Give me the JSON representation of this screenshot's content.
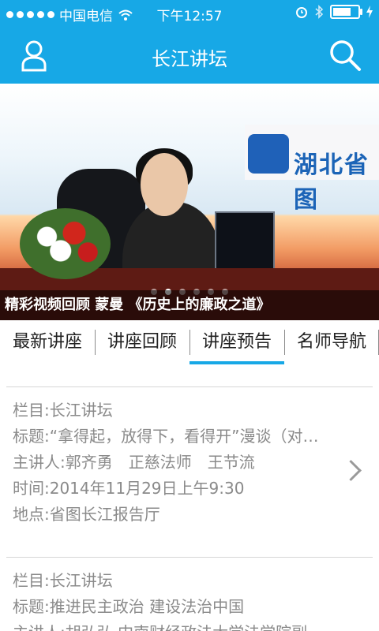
{
  "status_bar": {
    "carrier": "中国电信",
    "time": "下午12:57",
    "battery_level": 0.85
  },
  "nav": {
    "title": "长江讲坛",
    "user_icon": "user-icon",
    "search_icon": "search-icon"
  },
  "banner": {
    "caption": "精彩视频回顾  蒙曼 《历史上的廉政之道》",
    "sign_text": "湖北省图",
    "dots_count": 6,
    "active_dot": 1
  },
  "tabs": [
    {
      "label": "最新讲座",
      "active": false
    },
    {
      "label": "讲座回顾",
      "active": false
    },
    {
      "label": "讲座预告",
      "active": true
    },
    {
      "label": "名师导航",
      "active": false
    }
  ],
  "lectures": [
    {
      "column": "栏目:长江讲坛",
      "title": "标题:“拿得起，放得下，看得开”漫谈（对…",
      "speakers": "主讲人:郭齐勇　正慈法师　王节流",
      "time": "时间:2014年11月29日上午9:30",
      "place": "地点:省图长江报告厅"
    },
    {
      "column": "栏目:长江讲坛",
      "title": "标题:推进民主政治 建设法治中国",
      "speakers": "主讲人:胡弘弘 中南财经政法大学法学院副"
    }
  ],
  "colors": {
    "accent": "#17a8e6",
    "text_muted": "#8a8a8a"
  }
}
